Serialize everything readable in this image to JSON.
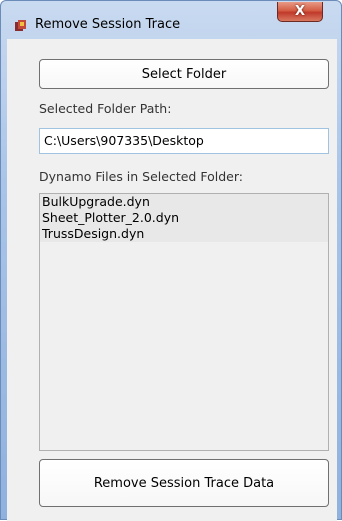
{
  "window": {
    "title": "Remove Session Trace",
    "close_glyph": "X",
    "app_icon": "revit-dynamo-app-icon"
  },
  "main": {
    "select_folder_label": "Select Folder",
    "path_label": "Selected Folder Path:",
    "path_value": "C:\\Users\\907335\\Desktop",
    "files_label": "Dynamo Files in Selected Folder:",
    "files": [
      "BulkUpgrade.dyn",
      "Sheet_Plotter_2.0.dyn",
      "TrussDesign.dyn"
    ],
    "remove_label": "Remove Session Trace Data"
  },
  "colors": {
    "titlebar": "#a9c4e8",
    "close_button": "#c0392b",
    "client_bg": "#f0f0f0",
    "input_border": "#9fc3e0"
  }
}
